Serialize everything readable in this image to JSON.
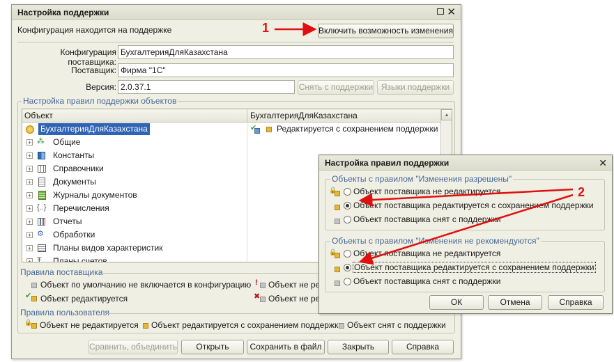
{
  "main_window": {
    "title": "Настройка поддержки",
    "status_text": "Конфигурация находится на поддержке",
    "enable_button": "Включить возможность изменения",
    "vendor_config_label": "Конфигурация поставщика:",
    "vendor_config_value": "БухгалтерияДляКазахстана",
    "vendor_label": "Поставщик:",
    "vendor_value": "Фирма \"1С\"",
    "version_label": "Версия:",
    "version_value": "2.0.37.1",
    "remove_support_button": "Снять с поддержки",
    "languages_button": "Языки поддержки",
    "rules_group": "Настройка правил поддержки объектов",
    "col_object": "Объект",
    "col_config": "БухгалтерияДляКазахстана",
    "tree": [
      {
        "label": "БухгалтерияДляКазахстана",
        "value": "Редактируется с сохранением поддержки",
        "icon": "config-icon"
      },
      {
        "label": "Общие",
        "icon": "common-icon"
      },
      {
        "label": "Константы",
        "icon": "constants-icon"
      },
      {
        "label": "Справочники",
        "icon": "catalogs-icon"
      },
      {
        "label": "Документы",
        "icon": "documents-icon"
      },
      {
        "label": "Журналы документов",
        "icon": "journals-icon"
      },
      {
        "label": "Перечисления",
        "icon": "enums-icon"
      },
      {
        "label": "Отчеты",
        "icon": "reports-icon"
      },
      {
        "label": "Обработки",
        "icon": "processing-icon"
      },
      {
        "label": "Планы видов характеристик",
        "icon": "chart-types-icon"
      },
      {
        "label": "Планы счетов",
        "icon": "accounts-icon"
      }
    ],
    "vendor_rules_title": "Правила поставщика",
    "vendor_rules": [
      "Объект по умолчанию не включается в конфигурацию",
      "Объект не реко",
      "Объект редактируется",
      "Объект не реко"
    ],
    "user_rules_title": "Правила пользователя",
    "user_rules": [
      "Объект не редактируется",
      "Объект редактируется с сохранением поддержки",
      "Объект снят с поддержки"
    ],
    "buttons": {
      "compare": "Сравнить, объединить",
      "open": "Открыть",
      "save": "Сохранить в файл",
      "close": "Закрыть",
      "help": "Справка"
    }
  },
  "dialog": {
    "title": "Настройка правил поддержки",
    "group1": "Объекты с правилом \"Изменения разрешены\"",
    "group2": "Объекты с правилом \"Изменения не рекомендуются\"",
    "options": [
      "Объект поставщика не редактируется",
      "Объект поставщика редактируется с сохранением поддержки",
      "Объект поставщика снят с поддержки"
    ],
    "group1_selected": 1,
    "group2_selected": 1,
    "ok": "ОК",
    "cancel": "Отмена",
    "help": "Справка"
  },
  "annotations": {
    "marker1": "1",
    "marker2": "2",
    "arrow_color": "#e01010"
  }
}
